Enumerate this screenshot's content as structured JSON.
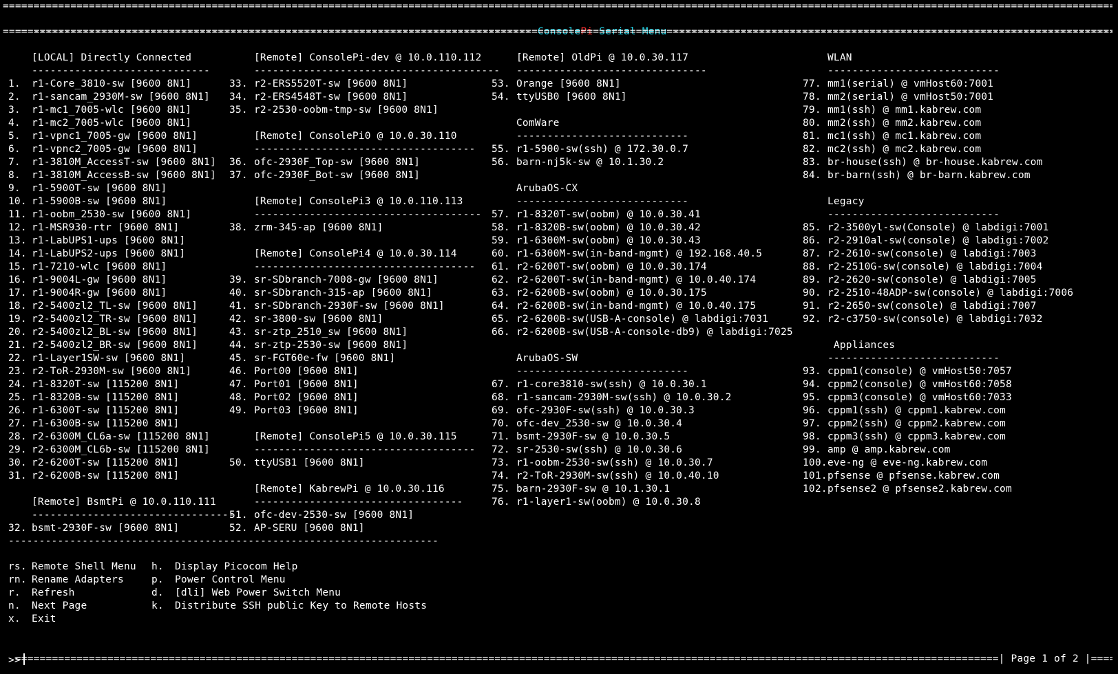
{
  "header": {
    "title_part1": "Console",
    "title_part2": "Pi",
    "title_part3": " Serial Menu",
    "accent_color": "#22d3e6",
    "pi_color": "#ff3030"
  },
  "columns": [
    {
      "sections": [
        {
          "title": "[LOCAL] Directly Connected",
          "items": [
            {
              "n": "1.",
              "label": "r1-Core_3810-sw [9600 8N1]"
            },
            {
              "n": "2.",
              "label": "r1-sancam_2930M-sw [9600 8N1]"
            },
            {
              "n": "3.",
              "label": "r1-mc1_7005-wlc [9600 8N1]"
            },
            {
              "n": "4.",
              "label": "r1-mc2_7005-wlc [9600 8N1]"
            },
            {
              "n": "5.",
              "label": "r1-vpnc1_7005-gw [9600 8N1]"
            },
            {
              "n": "6.",
              "label": "r1-vpnc2_7005-gw [9600 8N1]"
            },
            {
              "n": "7.",
              "label": "r1-3810M_AccessT-sw [9600 8N1]"
            },
            {
              "n": "8.",
              "label": "r1-3810M_AccessB-sw [9600 8N1]"
            },
            {
              "n": "9.",
              "label": "r1-5900T-sw [9600 8N1]"
            },
            {
              "n": "10.",
              "label": "r1-5900B-sw [9600 8N1]"
            },
            {
              "n": "11.",
              "label": "r1-oobm_2530-sw [9600 8N1]"
            },
            {
              "n": "12.",
              "label": "r1-MSR930-rtr [9600 8N1]"
            },
            {
              "n": "13.",
              "label": "r1-LabUPS1-ups [9600 8N1]"
            },
            {
              "n": "14.",
              "label": "r1-LabUPS2-ups [9600 8N1]"
            },
            {
              "n": "15.",
              "label": "r1-7210-wlc [9600 8N1]"
            },
            {
              "n": "16.",
              "label": "r1-9004L-gw [9600 8N1]"
            },
            {
              "n": "17.",
              "label": "r1-9004R-gw [9600 8N1]"
            },
            {
              "n": "18.",
              "label": "r2-5400zl2_TL-sw [9600 8N1]"
            },
            {
              "n": "19.",
              "label": "r2-5400zl2_TR-sw [9600 8N1]"
            },
            {
              "n": "20.",
              "label": "r2-5400zl2_BL-sw [9600 8N1]"
            },
            {
              "n": "21.",
              "label": "r2-5400zl2_BR-sw [9600 8N1]"
            },
            {
              "n": "22.",
              "label": "r1-Layer1SW-sw [9600 8N1]"
            },
            {
              "n": "23.",
              "label": "r2-ToR-2930M-sw [9600 8N1]"
            },
            {
              "n": "24.",
              "label": "r1-8320T-sw [115200 8N1]"
            },
            {
              "n": "25.",
              "label": "r1-8320B-sw [115200 8N1]"
            },
            {
              "n": "26.",
              "label": "r1-6300T-sw [115200 8N1]"
            },
            {
              "n": "27.",
              "label": "r1-6300B-sw [115200 8N1]"
            },
            {
              "n": "28.",
              "label": "r2-6300M_CL6a-sw [115200 8N1]"
            },
            {
              "n": "29.",
              "label": "r2-6300M_CL6b-sw [115200 8N1]"
            },
            {
              "n": "30.",
              "label": "r2-6200T-sw [115200 8N1]"
            },
            {
              "n": "31.",
              "label": "r2-6200B-sw [115200 8N1]"
            }
          ]
        },
        {
          "title": "[Remote] BsmtPi @ 10.0.110.111",
          "items": [
            {
              "n": "32.",
              "label": "bsmt-2930F-sw [9600 8N1]"
            }
          ]
        }
      ]
    },
    {
      "sections": [
        {
          "title": "[Remote] ConsolePi-dev @ 10.0.110.112",
          "items": [
            {
              "n": "33.",
              "label": "r2-ERS5520T-sw [9600 8N1]"
            },
            {
              "n": "34.",
              "label": "r2-ERS4548T-sw [9600 8N1]"
            },
            {
              "n": "35.",
              "label": "r2-2530-oobm-tmp-sw [9600 8N1]"
            }
          ]
        },
        {
          "title": "[Remote] ConsolePi0 @ 10.0.30.110",
          "items": [
            {
              "n": "36.",
              "label": "ofc-2930F_Top-sw [9600 8N1]"
            },
            {
              "n": "37.",
              "label": "ofc-2930F_Bot-sw [9600 8N1]"
            }
          ]
        },
        {
          "title": "[Remote] ConsolePi3 @ 10.0.110.113",
          "items": [
            {
              "n": "38.",
              "label": "zrm-345-ap [9600 8N1]"
            }
          ]
        },
        {
          "title": "[Remote] ConsolePi4 @ 10.0.30.114",
          "items": [
            {
              "n": "39.",
              "label": "sr-SDbranch-7008-gw [9600 8N1]"
            },
            {
              "n": "40.",
              "label": "sr-SDbranch-315-ap [9600 8N1]"
            },
            {
              "n": "41.",
              "label": "sr-SDbranch-2930F-sw [9600 8N1]"
            },
            {
              "n": "42.",
              "label": "sr-3800-sw [9600 8N1]"
            },
            {
              "n": "43.",
              "label": "sr-ztp_2510_sw [9600 8N1]"
            },
            {
              "n": "44.",
              "label": "sr-ztp-2530-sw [9600 8N1]"
            },
            {
              "n": "45.",
              "label": "sr-FGT60e-fw [9600 8N1]"
            },
            {
              "n": "46.",
              "label": "Port00 [9600 8N1]"
            },
            {
              "n": "47.",
              "label": "Port01 [9600 8N1]"
            },
            {
              "n": "48.",
              "label": "Port02 [9600 8N1]"
            },
            {
              "n": "49.",
              "label": "Port03 [9600 8N1]"
            }
          ]
        },
        {
          "title": "[Remote] ConsolePi5 @ 10.0.30.115",
          "items": [
            {
              "n": "50.",
              "label": "ttyUSB1 [9600 8N1]"
            }
          ]
        },
        {
          "title": "[Remote] KabrewPi @ 10.0.30.116",
          "items": [
            {
              "n": "51.",
              "label": "ofc-dev-2530-sw [9600 8N1]"
            },
            {
              "n": "52.",
              "label": "AP-SERU [9600 8N1]"
            }
          ]
        }
      ]
    },
    {
      "sections": [
        {
          "title": "[Remote] OldPi @ 10.0.30.117",
          "items": [
            {
              "n": "53.",
              "label": "Orange [9600 8N1]"
            },
            {
              "n": "54.",
              "label": "ttyUSB0 [9600 8N1]"
            }
          ]
        },
        {
          "title": "ComWare",
          "items": [
            {
              "n": "55.",
              "label": "r1-5900-sw(ssh) @ 172.30.0.7"
            },
            {
              "n": "56.",
              "label": "barn-nj5k-sw @ 10.1.30.2"
            }
          ]
        },
        {
          "title": "ArubaOS-CX",
          "items": [
            {
              "n": "57.",
              "label": "r1-8320T-sw(oobm) @ 10.0.30.41"
            },
            {
              "n": "58.",
              "label": "r1-8320B-sw(oobm) @ 10.0.30.42"
            },
            {
              "n": "59.",
              "label": "r1-6300M-sw(oobm) @ 10.0.30.43"
            },
            {
              "n": "60.",
              "label": "r1-6300M-sw(in-band-mgmt) @ 192.168.40.5"
            },
            {
              "n": "61.",
              "label": "r2-6200T-sw(oobm) @ 10.0.30.174"
            },
            {
              "n": "62.",
              "label": "r2-6200T-sw(in-band-mgmt) @ 10.0.40.174"
            },
            {
              "n": "63.",
              "label": "r2-6200B-sw(oobm) @ 10.0.30.175"
            },
            {
              "n": "64.",
              "label": "r2-6200B-sw(in-band-mgmt) @ 10.0.40.175"
            },
            {
              "n": "65.",
              "label": "r2-6200B-sw(USB-A-console) @ labdigi:7031"
            },
            {
              "n": "66.",
              "label": "r2-6200B-sw(USB-A-console-db9) @ labdigi:7025"
            }
          ]
        },
        {
          "title": "ArubaOS-SW",
          "items": [
            {
              "n": "67.",
              "label": "r1-core3810-sw(ssh) @ 10.0.30.1"
            },
            {
              "n": "68.",
              "label": "r1-sancam-2930M-sw(ssh) @ 10.0.30.2"
            },
            {
              "n": "69.",
              "label": "ofc-2930F-sw(ssh) @ 10.0.30.3"
            },
            {
              "n": "70.",
              "label": "ofc-dev_2530-sw @ 10.0.30.4"
            },
            {
              "n": "71.",
              "label": "bsmt-2930F-sw @ 10.0.30.5"
            },
            {
              "n": "72.",
              "label": "sr-2530-sw(ssh) @ 10.0.30.6"
            },
            {
              "n": "73.",
              "label": "r1-oobm-2530-sw(ssh) @ 10.0.30.7"
            },
            {
              "n": "74.",
              "label": "r2-ToR-2930M-sw(ssh) @ 10.0.40.10"
            },
            {
              "n": "75.",
              "label": "barn-2930F-sw @ 10.1.30.1"
            },
            {
              "n": "76.",
              "label": "r1-layer1-sw(oobm) @ 10.0.30.8"
            }
          ]
        }
      ]
    },
    {
      "sections": [
        {
          "title": "WLAN",
          "items": [
            {
              "n": "77.",
              "label": "mm1(serial) @ vmHost60:7001"
            },
            {
              "n": "78.",
              "label": "mm2(serial) @ vmHost50:7001"
            },
            {
              "n": "79.",
              "label": "mm1(ssh) @ mm1.kabrew.com"
            },
            {
              "n": "80.",
              "label": "mm2(ssh) @ mm2.kabrew.com"
            },
            {
              "n": "81.",
              "label": "mc1(ssh) @ mc1.kabrew.com"
            },
            {
              "n": "82.",
              "label": "mc2(ssh) @ mc2.kabrew.com"
            },
            {
              "n": "83.",
              "label": "br-house(ssh) @ br-house.kabrew.com"
            },
            {
              "n": "84.",
              "label": "br-barn(ssh) @ br-barn.kabrew.com"
            }
          ]
        },
        {
          "title": "Legacy",
          "items": [
            {
              "n": "85.",
              "label": "r2-3500yl-sw(Console) @ labdigi:7001"
            },
            {
              "n": "86.",
              "label": "r2-2910al-sw(console) @ labdigi:7002"
            },
            {
              "n": "87.",
              "label": "r2-2610-sw(console) @ labdigi:7003"
            },
            {
              "n": "88.",
              "label": "r2-2510G-sw(console) @ labdigi:7004"
            },
            {
              "n": "89.",
              "label": "r2-2620-sw(console) @ labdigi:7005"
            },
            {
              "n": "90.",
              "label": "r2-2510-48ADP-sw(console) @ labdigi:7006"
            },
            {
              "n": "91.",
              "label": "r2-2650-sw(console) @ labdigi:7007"
            },
            {
              "n": "92.",
              "label": "r2-c3750-sw(console) @ labdigi:7032"
            }
          ]
        },
        {
          "title": " Appliances",
          "items": [
            {
              "n": "93.",
              "label": "cppm1(console) @ vmHost50:7057"
            },
            {
              "n": "94.",
              "label": "cppm2(console) @ vmHost60:7058"
            },
            {
              "n": "95.",
              "label": "cppm3(console) @ vmHost60:7033"
            },
            {
              "n": "96.",
              "label": "cppm1(ssh) @ cppm1.kabrew.com"
            },
            {
              "n": "97.",
              "label": "cppm2(ssh) @ cppm2.kabrew.com"
            },
            {
              "n": "98.",
              "label": "cppm3(ssh) @ cppm3.kabrew.com"
            },
            {
              "n": "99.",
              "label": "amp @ amp.kabrew.com"
            },
            {
              "n": "100.",
              "label": "eve-ng @ eve-ng.kabrew.com"
            },
            {
              "n": "101.",
              "label": "pfsense @ pfsense.kabrew.com"
            },
            {
              "n": "102.",
              "label": "pfsense2 @ pfsense2.kabrew.com"
            }
          ]
        }
      ]
    }
  ],
  "menu": {
    "left": [
      {
        "key": "rs.",
        "label": "Remote Shell Menu"
      },
      {
        "key": "rn.",
        "label": "Rename Adapters"
      },
      {
        "key": "r.",
        "label": "Refresh"
      },
      {
        "key": "n.",
        "label": "Next Page"
      },
      {
        "key": "x.",
        "label": "Exit"
      }
    ],
    "right": [
      {
        "key": "h.",
        "label": "Display Picocom Help"
      },
      {
        "key": "p.",
        "label": "Power Control Menu"
      },
      {
        "key": "d.",
        "label": "[dli] Web Power Switch Menu"
      },
      {
        "key": "k.",
        "label": "Distribute SSH public Key to Remote Hosts"
      }
    ]
  },
  "page_indicator": "Page 1 of 2",
  "prompt": ">>"
}
